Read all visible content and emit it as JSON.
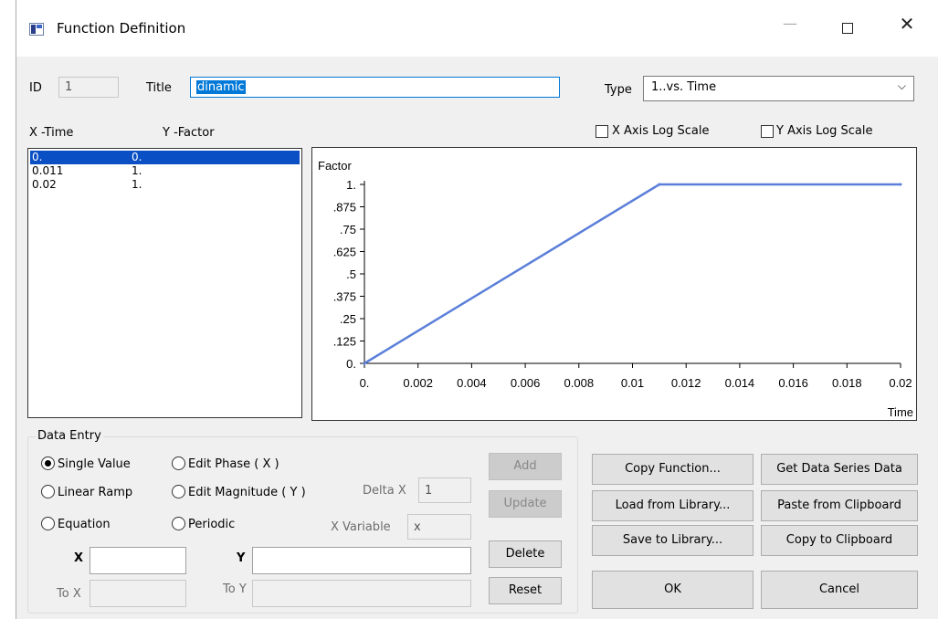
{
  "window": {
    "title": "Function Definition",
    "min_glyph": "—",
    "close_glyph": "✕"
  },
  "header": {
    "id_label": "ID",
    "id_value": "1",
    "title_label": "Title",
    "title_value": "dinamic",
    "type_label": "Type",
    "type_value": "1..vs. Time",
    "type_chevron": "⌵"
  },
  "columns": {
    "x_label": "X -Time",
    "y_label": "Y -Factor"
  },
  "log_scale": {
    "x_label": "X Axis Log Scale",
    "x_checked": false,
    "y_label": "Y Axis Log Scale",
    "y_checked": false
  },
  "table": {
    "rows": [
      {
        "x": "0.",
        "y": "0.",
        "selected": true
      },
      {
        "x": "0.011",
        "y": "1.",
        "selected": false
      },
      {
        "x": "0.02",
        "y": "1.",
        "selected": false
      }
    ]
  },
  "chart_data": {
    "type": "line",
    "title": "",
    "xlabel": "Time",
    "ylabel": "Factor",
    "xlim": [
      0,
      0.02
    ],
    "ylim": [
      0,
      1
    ],
    "x_ticks": [
      "0.",
      "0.002",
      "0.004",
      "0.006",
      "0.008",
      "0.01",
      "0.012",
      "0.014",
      "0.016",
      "0.018",
      "0.02"
    ],
    "y_ticks": [
      "0.",
      ".125",
      ".25",
      ".375",
      ".5",
      ".625",
      ".75",
      ".875",
      "1."
    ],
    "series": [
      {
        "x": [
          0,
          0.011,
          0.02
        ],
        "y": [
          0,
          1,
          1
        ],
        "color": "#5b7fd9"
      }
    ],
    "grid": false
  },
  "data_entry": {
    "group_label": "Data Entry",
    "radios": {
      "single_value": "Single Value",
      "linear_ramp": "Linear Ramp",
      "equation": "Equation",
      "edit_phase": "Edit Phase ( X )",
      "edit_magnitude": "Edit Magnitude ( Y )",
      "periodic": "Periodic"
    },
    "selected_mode": "single_value",
    "delta_x_label": "Delta X",
    "delta_x_value": "1",
    "x_variable_label": "X Variable",
    "x_variable_value": "x",
    "x_label": "X",
    "x_value": "",
    "y_label": "Y",
    "y_value": "",
    "to_x_label": "To X",
    "to_x_value": "",
    "to_y_label": "To Y",
    "to_y_value": ""
  },
  "buttons": {
    "add": "Add",
    "update": "Update",
    "delete": "Delete",
    "reset": "Reset",
    "copy_function": "Copy Function...",
    "load_library": "Load from Library...",
    "save_library": "Save to Library...",
    "get_series": "Get Data Series Data",
    "paste_clipboard": "Paste from Clipboard",
    "copy_clipboard": "Copy to Clipboard",
    "ok": "OK",
    "cancel": "Cancel"
  }
}
